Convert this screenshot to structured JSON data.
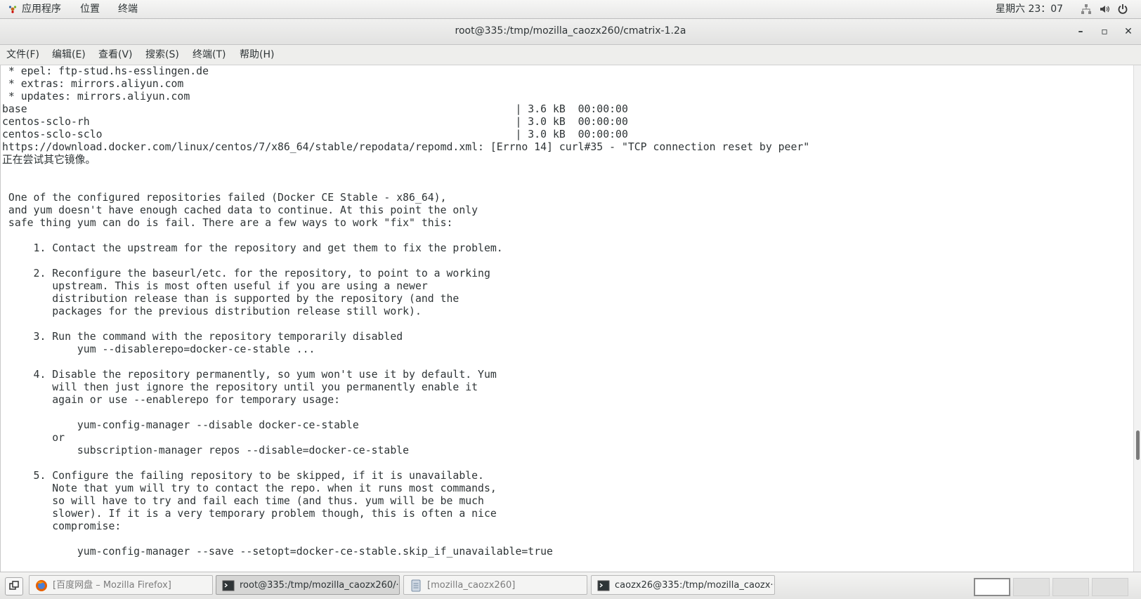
{
  "top_panel": {
    "applications": "应用程序",
    "places": "位置",
    "terminal": "终端",
    "clock": "星期六 23：07"
  },
  "window": {
    "title": "root@335:/tmp/mozilla_caozx260/cmatrix-1.2a",
    "minimize": "–",
    "maximize": "▫",
    "close": "✕"
  },
  "menu": {
    "file": "文件(F)",
    "edit": "编辑(E)",
    "view": "查看(V)",
    "search": "搜索(S)",
    "terminal": "终端(T)",
    "help": "帮助(H)"
  },
  "terminal_lines": [
    " * epel: ftp-stud.hs-esslingen.de",
    " * extras: mirrors.aliyun.com",
    " * updates: mirrors.aliyun.com",
    "base                                                                              | 3.6 kB  00:00:00",
    "centos-sclo-rh                                                                    | 3.0 kB  00:00:00",
    "centos-sclo-sclo                                                                  | 3.0 kB  00:00:00",
    "https://download.docker.com/linux/centos/7/x86_64/stable/repodata/repomd.xml: [Errno 14] curl#35 - \"TCP connection reset by peer\"",
    "正在尝试其它镜像。",
    "",
    "",
    " One of the configured repositories failed (Docker CE Stable - x86_64),",
    " and yum doesn't have enough cached data to continue. At this point the only",
    " safe thing yum can do is fail. There are a few ways to work \"fix\" this:",
    "",
    "     1. Contact the upstream for the repository and get them to fix the problem.",
    "",
    "     2. Reconfigure the baseurl/etc. for the repository, to point to a working",
    "        upstream. This is most often useful if you are using a newer",
    "        distribution release than is supported by the repository (and the",
    "        packages for the previous distribution release still work).",
    "",
    "     3. Run the command with the repository temporarily disabled",
    "            yum --disablerepo=docker-ce-stable ...",
    "",
    "     4. Disable the repository permanently, so yum won't use it by default. Yum",
    "        will then just ignore the repository until you permanently enable it",
    "        again or use --enablerepo for temporary usage:",
    "",
    "            yum-config-manager --disable docker-ce-stable",
    "        or",
    "            subscription-manager repos --disable=docker-ce-stable",
    "",
    "     5. Configure the failing repository to be skipped, if it is unavailable.",
    "        Note that yum will try to contact the repo. when it runs most commands,",
    "        so will have to try and fail each time (and thus. yum will be be much",
    "        slower). If it is a very temporary problem though, this is often a nice",
    "        compromise:",
    "",
    "            yum-config-manager --save --setopt=docker-ce-stable.skip_if_unavailable=true"
  ],
  "taskbar": {
    "tasks": [
      {
        "label": "[百度网盘 – Mozilla Firefox]",
        "icon": "firefox-icon"
      },
      {
        "label": "root@335:/tmp/mozilla_caozx260/···",
        "icon": "terminal-icon"
      },
      {
        "label": "[mozilla_caozx260]",
        "icon": "file-manager-icon"
      },
      {
        "label": "caozx26@335:/tmp/mozilla_caozx···",
        "icon": "terminal-icon"
      }
    ]
  },
  "colors": {
    "panel_bg": "#ececeb",
    "terminal_bg": "#ffffff",
    "terminal_fg": "#2e3436"
  }
}
